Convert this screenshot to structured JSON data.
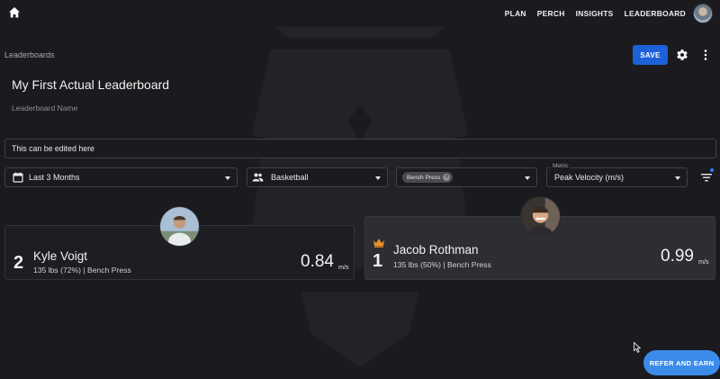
{
  "nav": {
    "items": [
      "PLAN",
      "PERCH",
      "INSIGHTS",
      "LEADERBOARD"
    ]
  },
  "breadcrumb": "Leaderboards",
  "toolbar": {
    "save_label": "SAVE"
  },
  "leaderboard": {
    "title": "My First Actual Leaderboard",
    "name_label": "Leaderboard Name",
    "description": "This can be edited here"
  },
  "filters": {
    "date_range": "Last 3 Months",
    "group": "Basketball",
    "exercise_chip": "Bench Press",
    "metric_label": "Metric",
    "metric_value": "Peak Velocity (m/s)"
  },
  "entries": [
    {
      "rank": "2",
      "name": "Kyle Voigt",
      "detail": "135 lbs (72%) | Bench Press",
      "value": "0.84",
      "unit": "m/s"
    },
    {
      "rank": "1",
      "name": "Jacob Rothman",
      "detail": "135 lbs (50%) | Bench Press",
      "value": "0.99",
      "unit": "m/s"
    }
  ],
  "refer_label": "REFER AND EARN",
  "colors": {
    "accent": "#1e60d8",
    "refer": "#3b8bea",
    "crown": "#e8922c",
    "background": "#1b1b1f"
  }
}
